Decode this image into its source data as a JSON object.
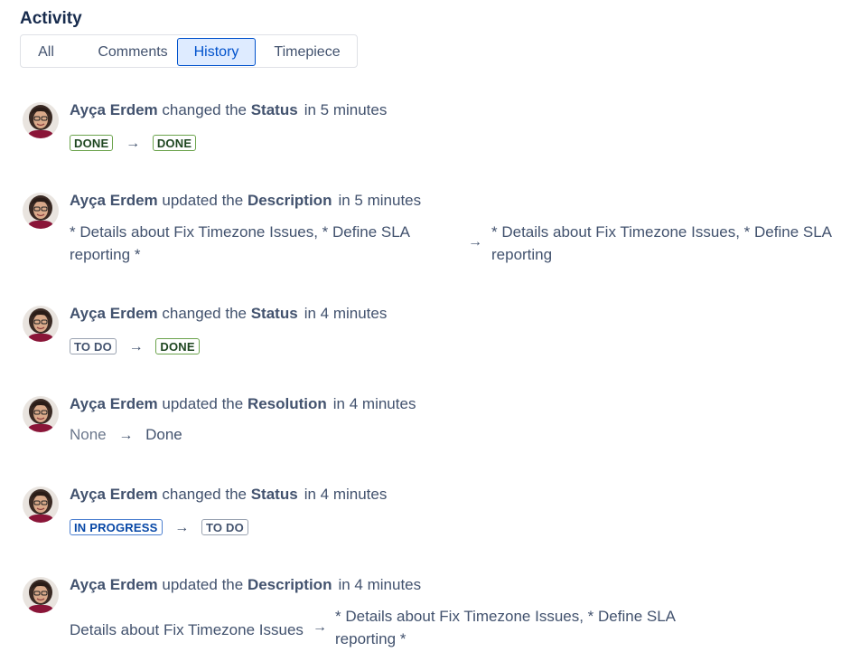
{
  "header": {
    "title": "Activity"
  },
  "tabs": [
    {
      "label": "All"
    },
    {
      "label": "Comments"
    },
    {
      "label": "History",
      "selected": true
    },
    {
      "label": "Timepiece"
    }
  ],
  "entries": [
    {
      "user": "Ayça Erdem",
      "action": "changed the",
      "field": "Status",
      "time": "in 5 minutes",
      "from": "DONE",
      "to": "DONE"
    },
    {
      "user": "Ayça Erdem",
      "action": "updated the",
      "field": "Description",
      "time": "in 5 minutes",
      "from_line1": "* Details about Fix Timezone Issues, * Define SLA",
      "from_line2": "reporting *",
      "to_line1": "* Details about Fix Timezone Issues, * Define SLA",
      "to_line2": "reporting"
    },
    {
      "user": "Ayça Erdem",
      "action": "changed the",
      "field": "Status",
      "time": "in 4 minutes",
      "from": "TO DO",
      "to": "DONE"
    },
    {
      "user": "Ayça Erdem",
      "action": "updated the",
      "field": "Resolution",
      "time": "in 4 minutes",
      "from": "None",
      "to": "Done"
    },
    {
      "user": "Ayça Erdem",
      "action": "changed the",
      "field": "Status",
      "time": "in 4 minutes",
      "from": "IN PROGRESS",
      "to": "TO DO"
    },
    {
      "user": "Ayça Erdem",
      "action": "updated the",
      "field": "Description",
      "time": "in 4 minutes",
      "from": "Details about Fix Timezone Issues",
      "to_line1": "* Details about Fix Timezone Issues, * Define SLA",
      "to_line2": "reporting *"
    }
  ],
  "arrow": "→",
  "colors": {
    "done": "#6ba34c",
    "todo": "#9aa3b1",
    "in_progress": "#4c7fd0",
    "selected_tab": "#0052cc"
  },
  "icons": {
    "avatar": "user-avatar-photo"
  }
}
